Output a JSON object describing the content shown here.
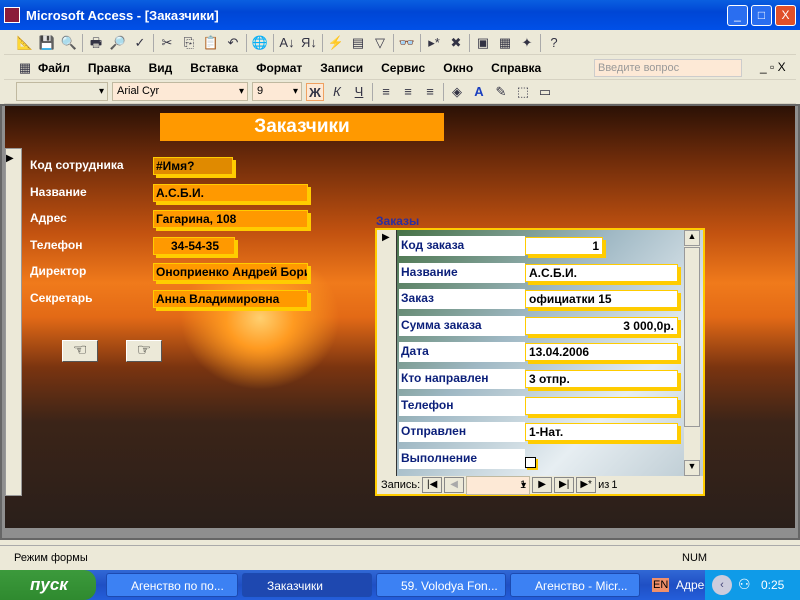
{
  "window": {
    "title": "Microsoft Access - [Заказчики]",
    "min": "_",
    "max": "□",
    "close": "X"
  },
  "toolbar": {
    "icons": [
      "design-view",
      "save",
      "print-preview",
      "print",
      "search",
      "spell",
      "cut",
      "copy",
      "paste",
      "undo",
      "hyperlink",
      "sort-asc",
      "sort-desc",
      "filter-selection",
      "filter-form",
      "filter",
      "find",
      "new-record",
      "delete-record",
      "properties",
      "database-window",
      "new-object",
      "help"
    ]
  },
  "menu": {
    "items": [
      "Файл",
      "Правка",
      "Вид",
      "Вставка",
      "Формат",
      "Записи",
      "Сервис",
      "Окно",
      "Справка"
    ],
    "ask_placeholder": "Введите вопрос"
  },
  "format": {
    "object": "",
    "font": "Arial Cyr",
    "size": "9",
    "bold": "Ж",
    "italic": "К",
    "underline": "Ч"
  },
  "form": {
    "title": "Заказчики",
    "fields": [
      {
        "label": "Код сотрудника",
        "value": "#Имя?"
      },
      {
        "label": "Название",
        "value": "А.С.Б.И."
      },
      {
        "label": "Адрес",
        "value": "Гагарина, 108"
      },
      {
        "label": "Телефон",
        "value": "34-54-35"
      },
      {
        "label": "Директор",
        "value": "Оноприенко Андрей Бори"
      },
      {
        "label": "Секретарь",
        "value": "Анна Владимировна"
      }
    ],
    "prev_button": "☜",
    "next_button": "☞"
  },
  "subform": {
    "title": "Заказы",
    "fields": [
      {
        "label": "Код заказа",
        "value": "1"
      },
      {
        "label": "Название",
        "value": "А.С.Б.И."
      },
      {
        "label": "Заказ",
        "value": "официатки 15"
      },
      {
        "label": "Сумма заказа",
        "value": "3 000,0р."
      },
      {
        "label": "Дата",
        "value": "13.04.2006"
      },
      {
        "label": "Кто направлен",
        "value": "3 отпр."
      },
      {
        "label": "Телефон",
        "value": ""
      },
      {
        "label": "Отправлен",
        "value": "1-Нат."
      },
      {
        "label": "Выполнение",
        "value": ""
      }
    ],
    "nav": {
      "label": "Запись:",
      "current": "1",
      "of": "из",
      "total": "1"
    }
  },
  "status": {
    "mode": "Режим формы",
    "num": "NUM"
  },
  "taskbar": {
    "start": "пуск",
    "tasks": [
      "Агенство по по...",
      "Заказчики",
      "59. Volodya Fon...",
      "Агенство - Micr..."
    ],
    "lang": "EN",
    "address": "Адрес:",
    "time": "0:25"
  }
}
